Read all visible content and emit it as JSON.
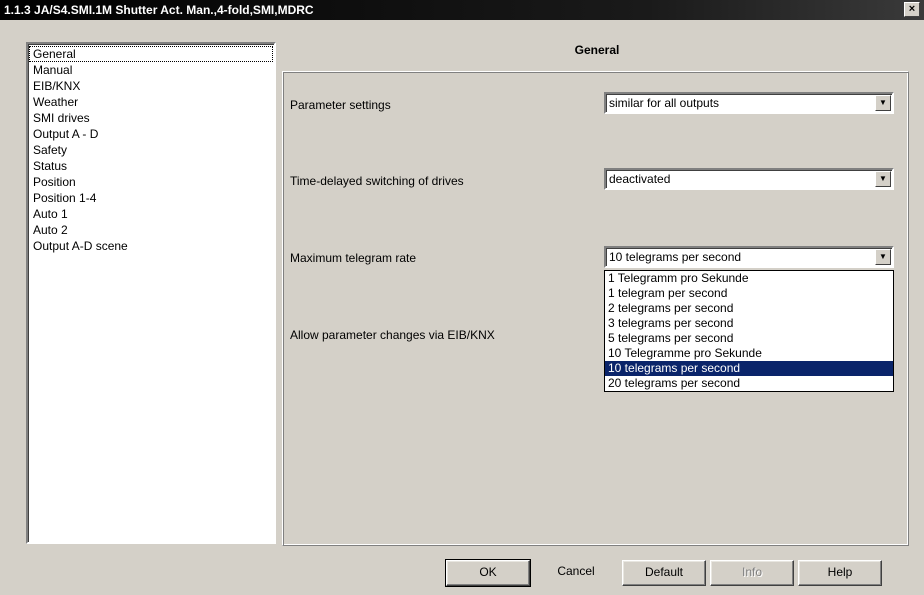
{
  "window": {
    "title": "1.1.3 JA/S4.SMI.1M Shutter Act. Man.,4-fold,SMI,MDRC",
    "close_label": "×"
  },
  "sidebar": {
    "items": [
      {
        "label": "General",
        "selected": true
      },
      {
        "label": "Manual"
      },
      {
        "label": "EIB/KNX"
      },
      {
        "label": "Weather"
      },
      {
        "label": "SMI drives"
      },
      {
        "label": "Output A - D"
      },
      {
        "label": "Safety"
      },
      {
        "label": "Status"
      },
      {
        "label": "Position"
      },
      {
        "label": "Position 1-4"
      },
      {
        "label": "Auto 1"
      },
      {
        "label": "Auto 2"
      },
      {
        "label": "Output A-D scene"
      }
    ]
  },
  "main": {
    "section_title": "General",
    "params": [
      {
        "label": "Parameter settings",
        "value": "similar for all outputs"
      },
      {
        "label": "Time-delayed switching of drives",
        "value": "deactivated"
      },
      {
        "label": "Maximum telegram rate",
        "value": "10 telegrams per second"
      },
      {
        "label": "Allow parameter changes via EIB/KNX",
        "value": ""
      }
    ],
    "dropdown_options": [
      "1 Telegramm pro Sekunde",
      "1 telegram per second",
      "2  telegrams per second",
      "3  telegrams per second",
      "5  telegrams per second",
      "10 Telegramme pro Sekunde",
      "10 telegrams per second",
      "20 telegrams per second"
    ],
    "dropdown_selected_index": 6
  },
  "buttons": {
    "ok": "OK",
    "cancel": "Cancel",
    "default": "Default",
    "info": "Info",
    "help": "Help"
  },
  "icons": {
    "dropdown_arrow": "▼"
  }
}
